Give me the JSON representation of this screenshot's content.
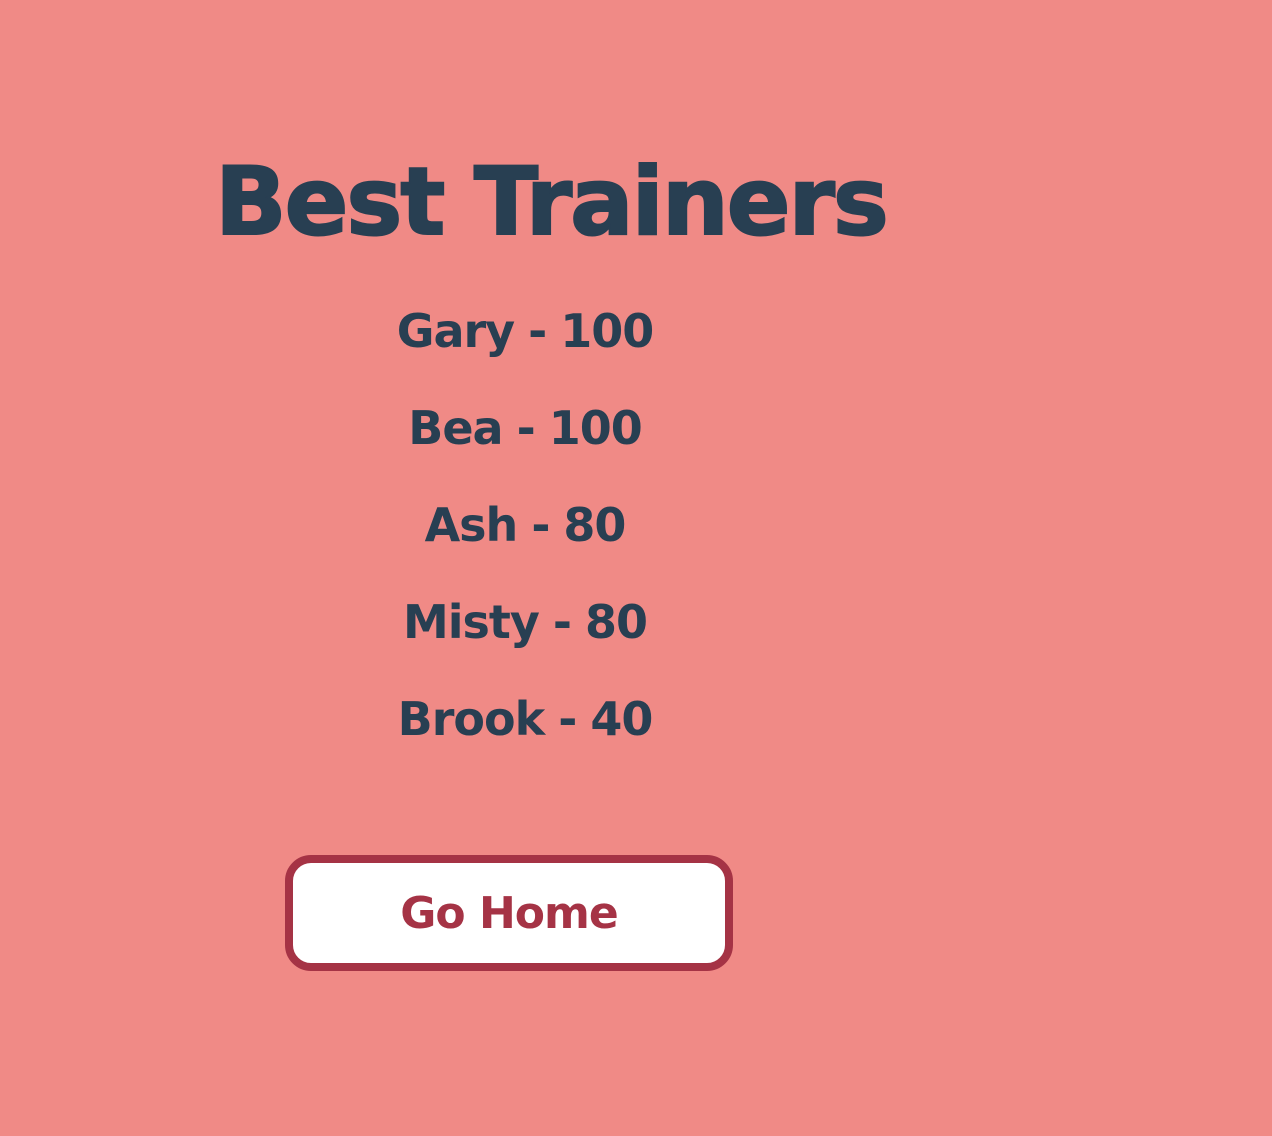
{
  "title": "Best Trainers",
  "trainers": [
    {
      "name": "Gary",
      "separator": "-",
      "score": "100"
    },
    {
      "name": "Bea",
      "separator": "-",
      "score": "100"
    },
    {
      "name": "Ash",
      "separator": "-",
      "score": "80"
    },
    {
      "name": "Misty",
      "separator": "-",
      "score": "80"
    },
    {
      "name": "Brook",
      "separator": "-",
      "score": "40"
    }
  ],
  "home_button": {
    "label": "Go Home"
  },
  "colors": {
    "background": "#f08a86",
    "text": "#283f52",
    "button_accent": "#a53345",
    "button_background": "#ffffff"
  }
}
